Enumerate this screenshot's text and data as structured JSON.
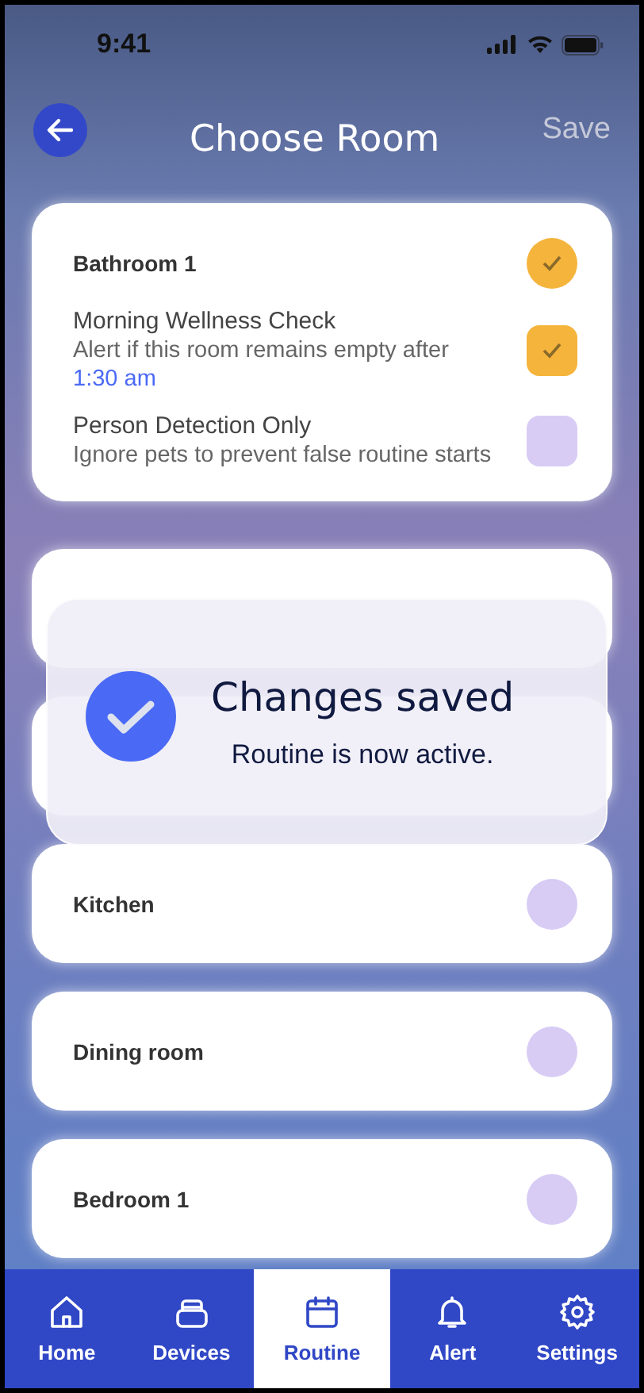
{
  "status_bar": {
    "time": "9:41"
  },
  "header": {
    "title": "Choose Room",
    "action": "Save"
  },
  "rooms": [
    {
      "kind": "detail",
      "name": "Bathroom 1",
      "selected": true,
      "options": [
        {
          "title": "Morning Wellness Check",
          "description": "Alert if this room remains empty after",
          "link": "1:30 am",
          "checked": true
        },
        {
          "title": "Person Detection Only",
          "description": "Ignore pets to prevent false routine starts",
          "checked": false
        }
      ]
    },
    {
      "kind": "covered"
    },
    {
      "kind": "covered"
    },
    {
      "kind": "room",
      "name": "Kitchen",
      "selected": false
    },
    {
      "kind": "room",
      "name": "Dining room",
      "selected": false
    },
    {
      "kind": "room",
      "name": "Bedroom 1",
      "selected": false
    }
  ],
  "toast": {
    "title": "Changes saved",
    "message": "Routine is now active."
  },
  "nav": [
    {
      "kind": "home",
      "label": "Home",
      "selected": false
    },
    {
      "kind": "devices",
      "label": "Devices",
      "selected": false
    },
    {
      "kind": "routine",
      "label": "Routine",
      "selected": true
    },
    {
      "kind": "alert",
      "label": "Alert",
      "selected": false
    },
    {
      "kind": "settings",
      "label": "Settings",
      "selected": false
    }
  ]
}
